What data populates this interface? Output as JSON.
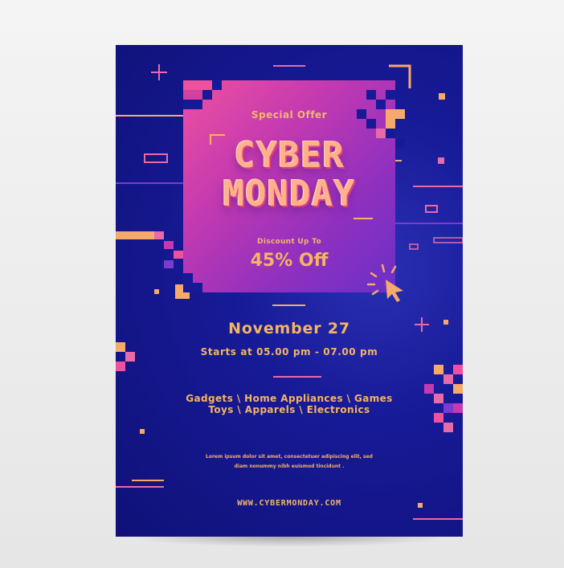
{
  "flyer": {
    "special_offer": "Special Offer",
    "headline_line1": "CYBER",
    "headline_line2": "MONDAY",
    "discount_label": "Discount Up To",
    "discount_value": "45% Off",
    "date": "November 27",
    "time": "Starts at 05.00 pm - 07.00 pm",
    "categories_line1": "Gadgets \\ Home Appliances \\ Games",
    "categories_line2": "Toys \\ Apparels \\ Electronics",
    "body_line1": "Lorem ipsum dolor sit amet, consectetuer adipiscing elit, sed",
    "body_line2": "diam nonummy nibh euismod tincidunt .",
    "website": "WWW.CYBERMONDAY.COM"
  },
  "colors": {
    "background": "#171a96",
    "panel_pink": "#f050a0",
    "panel_purple": "#6a2fc6",
    "text_gold": "#f5b462"
  },
  "icons": {
    "cursor": "cursor-icon",
    "plus": "plus-icon"
  }
}
